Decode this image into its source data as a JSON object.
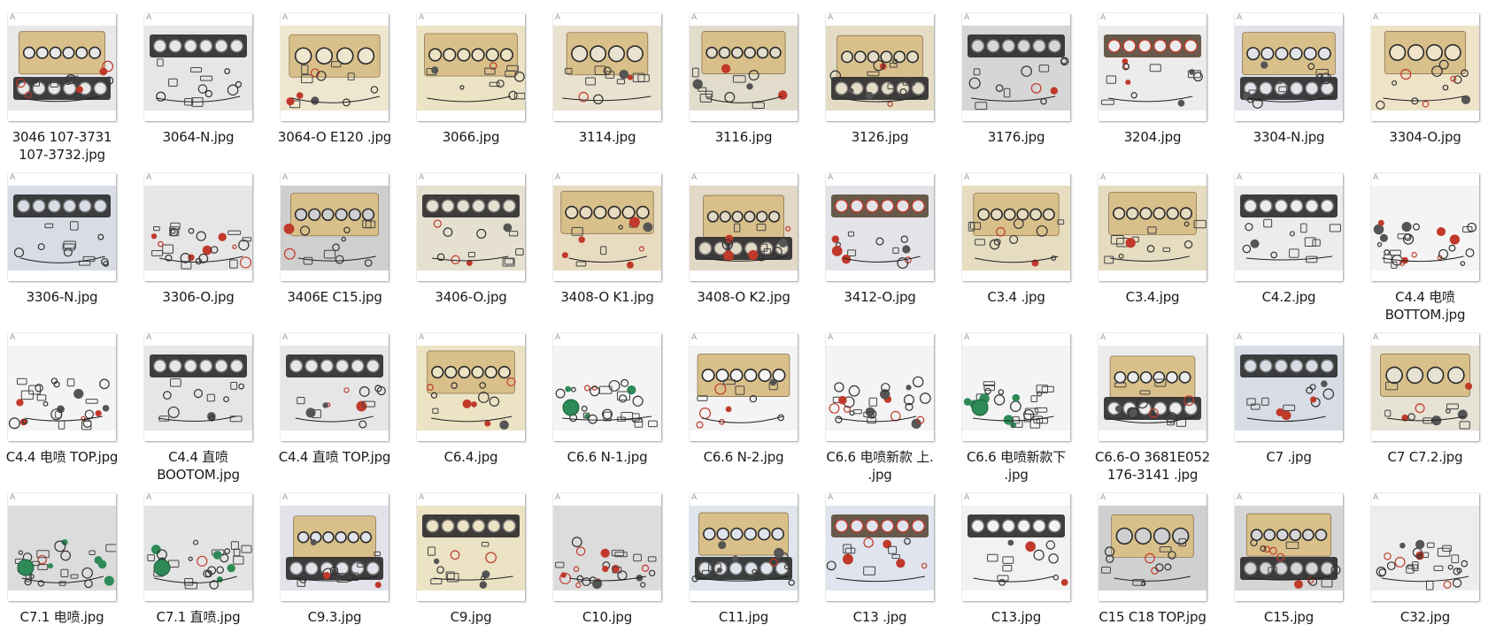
{
  "watermark_glyph": "A",
  "colors": {
    "gasket_gold": "#d9c08a",
    "gasket_black": "#2a2a2a",
    "ring_red": "#c0392b",
    "ring_green": "#2e8b57",
    "backdrop_gray": "#dcdcdc"
  },
  "files": [
    {
      "name": "3046 107-3731\n107-3732.jpg",
      "bg": "#e8e8e8",
      "style": "mixed"
    },
    {
      "name": "3064-N.jpg",
      "bg": "#e6e6e6",
      "style": "black-head"
    },
    {
      "name": "3064-O  E120 .jpg",
      "bg": "#efe6cf",
      "style": "gold-sheet"
    },
    {
      "name": "3066.jpg",
      "bg": "#ece2c4",
      "style": "gold-head"
    },
    {
      "name": "3114.jpg",
      "bg": "#e9e2d0",
      "style": "gold-sheet"
    },
    {
      "name": "3116.jpg",
      "bg": "#e2dccc",
      "style": "gold-head"
    },
    {
      "name": "3126.jpg",
      "bg": "#e4dcc5",
      "style": "mixed"
    },
    {
      "name": "3176.jpg",
      "bg": "#d6d6d6",
      "style": "black-head"
    },
    {
      "name": "3204.jpg",
      "bg": "#ececec",
      "style": "red-rings"
    },
    {
      "name": "3304-N.jpg",
      "bg": "#e2e2ea",
      "style": "mixed"
    },
    {
      "name": "3304-O.jpg",
      "bg": "#efe4c8",
      "style": "gold-sheet"
    },
    {
      "name": "3306-N.jpg",
      "bg": "#d8dce4",
      "style": "black-head"
    },
    {
      "name": "3306-O.jpg",
      "bg": "#e6e6e6",
      "style": "scattered"
    },
    {
      "name": "3406E C15.jpg",
      "bg": "#cfcfcf",
      "style": "gold-head"
    },
    {
      "name": "3406-O.jpg",
      "bg": "#e6e0d0",
      "style": "black-head"
    },
    {
      "name": "3408-O K1.jpg",
      "bg": "#e8dcc0",
      "style": "gold-head"
    },
    {
      "name": "3408-O K2.jpg",
      "bg": "#e2d8c6",
      "style": "mixed"
    },
    {
      "name": "3412-O.jpg",
      "bg": "#e4e4e8",
      "style": "red-rings"
    },
    {
      "name": "C3.4 .jpg",
      "bg": "#e6dcc0",
      "style": "gold-head"
    },
    {
      "name": "C3.4.jpg",
      "bg": "#e6dcc0",
      "style": "gold-head"
    },
    {
      "name": "C4.2.jpg",
      "bg": "#ececec",
      "style": "black-head"
    },
    {
      "name": "C4.4 电喷\nBOTTOM.jpg",
      "bg": "#f4f4f4",
      "style": "scattered"
    },
    {
      "name": "C4.4 电喷 TOP.jpg",
      "bg": "#f4f4f4",
      "style": "scattered"
    },
    {
      "name": "C4.4 直喷\nBOOTOM.jpg",
      "bg": "#e6e6e6",
      "style": "black-head"
    },
    {
      "name": "C4.4 直喷 TOP.jpg",
      "bg": "#e6e6e6",
      "style": "black-head"
    },
    {
      "name": "C6.4.jpg",
      "bg": "#ece2c4",
      "style": "gold-head"
    },
    {
      "name": "C6.6 N-1.jpg",
      "bg": "#f4f4f4",
      "style": "green-scatter"
    },
    {
      "name": "C6.6 N-2.jpg",
      "bg": "#f4f4f4",
      "style": "gold-head"
    },
    {
      "name": "C6.6 电喷新款 上.\n.jpg",
      "bg": "#f4f4f4",
      "style": "scattered"
    },
    {
      "name": "C6.6 电喷新款下\n.jpg",
      "bg": "#f4f4f4",
      "style": "green-scatter"
    },
    {
      "name": "C6.6-O 3681E052\n176-3141 .jpg",
      "bg": "#ececec",
      "style": "mixed"
    },
    {
      "name": "C7 .jpg",
      "bg": "#d8dce4",
      "style": "black-head"
    },
    {
      "name": "C7 C7.2.jpg",
      "bg": "#e6e2d4",
      "style": "gold-sheet"
    },
    {
      "name": "C7.1 电喷.jpg",
      "bg": "#dcdcdc",
      "style": "green-scatter"
    },
    {
      "name": "C7.1 直喷.jpg",
      "bg": "#e4e4e4",
      "style": "green-scatter"
    },
    {
      "name": "C9.3.jpg",
      "bg": "#e2e2ea",
      "style": "mixed"
    },
    {
      "name": "C9.jpg",
      "bg": "#ece2c4",
      "style": "black-head"
    },
    {
      "name": "C10.jpg",
      "bg": "#dcdcdc",
      "style": "scattered"
    },
    {
      "name": "C11.jpg",
      "bg": "#e0e4ec",
      "style": "mixed"
    },
    {
      "name": "C13 .jpg",
      "bg": "#dfe4ee",
      "style": "red-rings"
    },
    {
      "name": "C13.jpg",
      "bg": "#f2f2f2",
      "style": "black-head"
    },
    {
      "name": "C15 C18 TOP.jpg",
      "bg": "#d0d0d0",
      "style": "gold-sheet"
    },
    {
      "name": "C15.jpg",
      "bg": "#d6d6d6",
      "style": "mixed"
    },
    {
      "name": "C32.jpg",
      "bg": "#ededed",
      "style": "scattered"
    }
  ]
}
